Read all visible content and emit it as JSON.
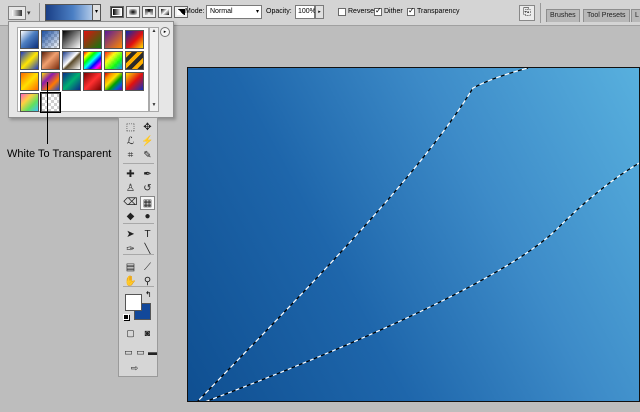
{
  "options_bar": {
    "mode_label": "Mode:",
    "mode_value": "Normal",
    "opacity_label": "Opacity:",
    "opacity_value": "100%",
    "reverse_label": "Reverse",
    "reverse_checked": false,
    "dither_label": "Dither",
    "dither_checked": true,
    "transparency_label": "Transparency",
    "transparency_checked": true,
    "gradient_types": [
      "linear-gradient-icon",
      "radial-gradient-icon",
      "angle-gradient-icon",
      "reflected-gradient-icon",
      "diamond-gradient-icon"
    ],
    "selected_gradient_type": "linear-gradient-icon"
  },
  "panel_well": {
    "tabs": [
      "Brushes",
      "Tool Presets",
      "L"
    ]
  },
  "gradient_picker": {
    "swatches": [
      {
        "name": "foreground-to-background",
        "css": "linear-gradient(135deg,#ffffff 0%,#4d7fc2 45%,#0c2f7a 100%)"
      },
      {
        "name": "foreground-to-transparent",
        "css": "linear-gradient(135deg,#1c4fa0 0%,rgba(255,255,255,0) 100%), repeating-conic-gradient(#ccc 0 25%,#fff 0 50%) 0 0/6px 6px"
      },
      {
        "name": "black-white",
        "css": "linear-gradient(135deg,#000 0%,#fff 100%)"
      },
      {
        "name": "red-green",
        "css": "linear-gradient(135deg,#e01010 0%,#107a10 100%)"
      },
      {
        "name": "violet-orange",
        "css": "linear-gradient(135deg,#5a1a9a 0%,#ff8a00 100%)"
      },
      {
        "name": "blue-red-yellow",
        "css": "linear-gradient(135deg,#0a2ab0 0%,#e01010 55%,#ffe000 100%)"
      },
      {
        "name": "blue-yellow-blue",
        "css": "linear-gradient(135deg,#1e3cc8 0%,#ffe600 50%,#1e3cc8 100%)"
      },
      {
        "name": "copper",
        "css": "linear-gradient(135deg,#5a1e08 0%,#f0a070 45%,#7a2a0c 100%)"
      },
      {
        "name": "chrome",
        "css": "linear-gradient(135deg,#1a3a8a 0%,#ffffff 45%,#5a4a2a 55%,#fff 100%)"
      },
      {
        "name": "spectrum",
        "css": "linear-gradient(135deg,#ff0000,#ffff00,#00ff00,#00ffff,#0000ff,#ff00ff,#ff0000)"
      },
      {
        "name": "transparent-rainbow",
        "css": "linear-gradient(135deg,rgba(255,0,0,.9),rgba(255,255,0,.9),rgba(0,255,0,.9),rgba(0,128,255,.9)), repeating-conic-gradient(#ccc 0 25%,#fff 0 50%) 0 0/6px 6px"
      },
      {
        "name": "transparent-stripes",
        "css": "repeating-linear-gradient(135deg,#ffb000 0 4px,#2a2a2a 4px 8px)"
      },
      {
        "name": "orange-yellow-orange",
        "css": "linear-gradient(135deg,#ff6a00 0%,#ffe000 50%,#ff6a00 100%)"
      },
      {
        "name": "yellow-violet-orange-blue",
        "css": "linear-gradient(135deg,#ffe000 0%,#8a1ab0 33%,#ff7a00 66%,#1a4ad0 100%)"
      },
      {
        "name": "blue-green-sheen",
        "css": "linear-gradient(135deg,#0a2a8a 0%,#00b070 50%,#0a2a8a 100%)"
      },
      {
        "name": "red-sheen",
        "css": "linear-gradient(135deg,#7a0000 0%,#ff3030 50%,#7a0000 100%)"
      },
      {
        "name": "rainbow-stripe",
        "css": "linear-gradient(135deg,#d00000,#ff9000,#ffe000,#00a000,#0060d0,#7000b0)"
      },
      {
        "name": "yellow-red-blue",
        "css": "linear-gradient(135deg,#ffe000 0%,#e01010 50%,#1030c0 100%)"
      },
      {
        "name": "pastel-rainbow",
        "css": "linear-gradient(135deg,#ff60c0,#ffd040,#60e060,#40c0ff)"
      },
      {
        "name": "transparent-checker",
        "css": "repeating-conic-gradient(#cfcfcf 0 25%,#ffffff 0 50%) 0 0/6px 6px"
      }
    ],
    "selected_index": 19,
    "callout_label": "White To Transparent"
  },
  "toolbox": {
    "tools": [
      {
        "name": "marquee-tool-icon",
        "glyph": "⬚"
      },
      {
        "name": "move-tool-icon",
        "glyph": "✥"
      },
      {
        "name": "lasso-tool-icon",
        "glyph": "ℒ"
      },
      {
        "name": "magic-wand-tool-icon",
        "glyph": "⚡"
      },
      {
        "name": "crop-tool-icon",
        "glyph": "⌗"
      },
      {
        "name": "slice-tool-icon",
        "glyph": "✎"
      },
      {
        "name": "healing-brush-tool-icon",
        "glyph": "✚"
      },
      {
        "name": "brush-tool-icon",
        "glyph": "✒"
      },
      {
        "name": "clone-stamp-tool-icon",
        "glyph": "♙"
      },
      {
        "name": "history-brush-tool-icon",
        "glyph": "↺"
      },
      {
        "name": "eraser-tool-icon",
        "glyph": "⌫"
      },
      {
        "name": "gradient-tool-icon",
        "glyph": "▦"
      },
      {
        "name": "blur-tool-icon",
        "glyph": "◆"
      },
      {
        "name": "dodge-tool-icon",
        "glyph": "●"
      },
      {
        "name": "path-selection-tool-icon",
        "glyph": "➤"
      },
      {
        "name": "type-tool-icon",
        "glyph": "T"
      },
      {
        "name": "pen-tool-icon",
        "glyph": "✑"
      },
      {
        "name": "line-tool-icon",
        "glyph": "╲"
      },
      {
        "name": "notes-tool-icon",
        "glyph": "▤"
      },
      {
        "name": "eyedropper-tool-icon",
        "glyph": "⟋"
      },
      {
        "name": "hand-tool-icon",
        "glyph": "✋"
      },
      {
        "name": "zoom-tool-icon",
        "glyph": "⚲"
      }
    ],
    "active_tool": "gradient-tool-icon",
    "foreground_color": "#ffffff",
    "background_color": "#12489a",
    "bottom_buttons": [
      {
        "name": "quick-mask-standard-icon",
        "glyph": "▢"
      },
      {
        "name": "quick-mask-mode-icon",
        "glyph": "◙"
      },
      {
        "name": "screen-mode-standard-icon",
        "glyph": "▭"
      },
      {
        "name": "screen-mode-maximized-icon",
        "glyph": "▭"
      },
      {
        "name": "screen-mode-full-icon",
        "glyph": "▬"
      },
      {
        "name": "jump-to-imageready-icon",
        "glyph": "⇨"
      }
    ]
  },
  "canvas": {
    "colors": {
      "gradient_dark": "#0f4f91",
      "gradient_light": "#58b0de"
    }
  }
}
